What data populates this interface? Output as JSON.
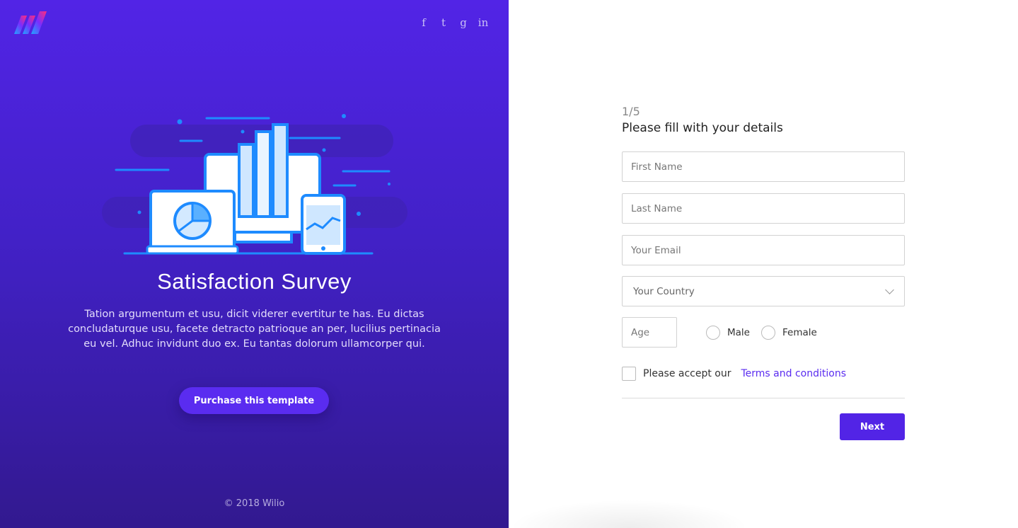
{
  "left": {
    "logo_icon": "wilio-logo-icon",
    "social": [
      "f",
      "t",
      "g",
      "in"
    ],
    "title": "Satisfaction Survey",
    "description": "Tation argumentum et usu, dicit viderer evertitur te has. Eu dictas concludaturque usu, facete detracto patrioque an per, lucilius pertinacia eu vel. Adhuc invidunt duo ex. Eu tantas dolorum ullamcorper qui.",
    "purchase_label": "Purchase this template",
    "copyright": "© 2018 Wilio"
  },
  "form": {
    "step": "1/5",
    "heading": "Please fill with your details",
    "first_name_placeholder": "First Name",
    "last_name_placeholder": "Last Name",
    "email_placeholder": "Your Email",
    "country_placeholder": "Your Country",
    "age_placeholder": "Age",
    "gender_male": "Male",
    "gender_female": "Female",
    "terms_prefix": "Please accept our",
    "terms_link": "Terms and conditions",
    "next_label": "Next"
  },
  "colors": {
    "accent": "#5224e6",
    "panel_top": "#5224e6",
    "panel_bottom": "#32198f"
  }
}
